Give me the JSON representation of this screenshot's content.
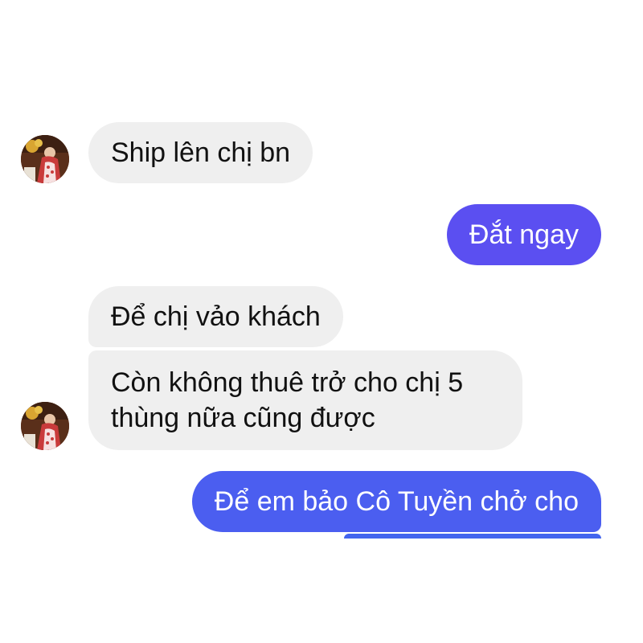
{
  "conversation": {
    "messages": [
      {
        "id": "msg1",
        "sender": "contact",
        "text": "Ship lên chị bn"
      },
      {
        "id": "msg2",
        "sender": "me",
        "text": "Đắt ngay"
      },
      {
        "id": "msg3",
        "sender": "contact",
        "text": "Để chị vảo khách"
      },
      {
        "id": "msg4",
        "sender": "contact",
        "text": "Còn không thuê trở cho chị 5 thùng nữa cũng được"
      },
      {
        "id": "msg5",
        "sender": "me",
        "text": "Để em bảo Cô Tuyền chở cho"
      }
    ]
  },
  "colors": {
    "incoming_bubble": "#efefef",
    "outgoing_bubble_top": "#5b4ff1",
    "outgoing_bubble_bottom": "#4b5ef0",
    "background": "#ffffff"
  },
  "icons": {
    "avatar": "contact-avatar"
  }
}
